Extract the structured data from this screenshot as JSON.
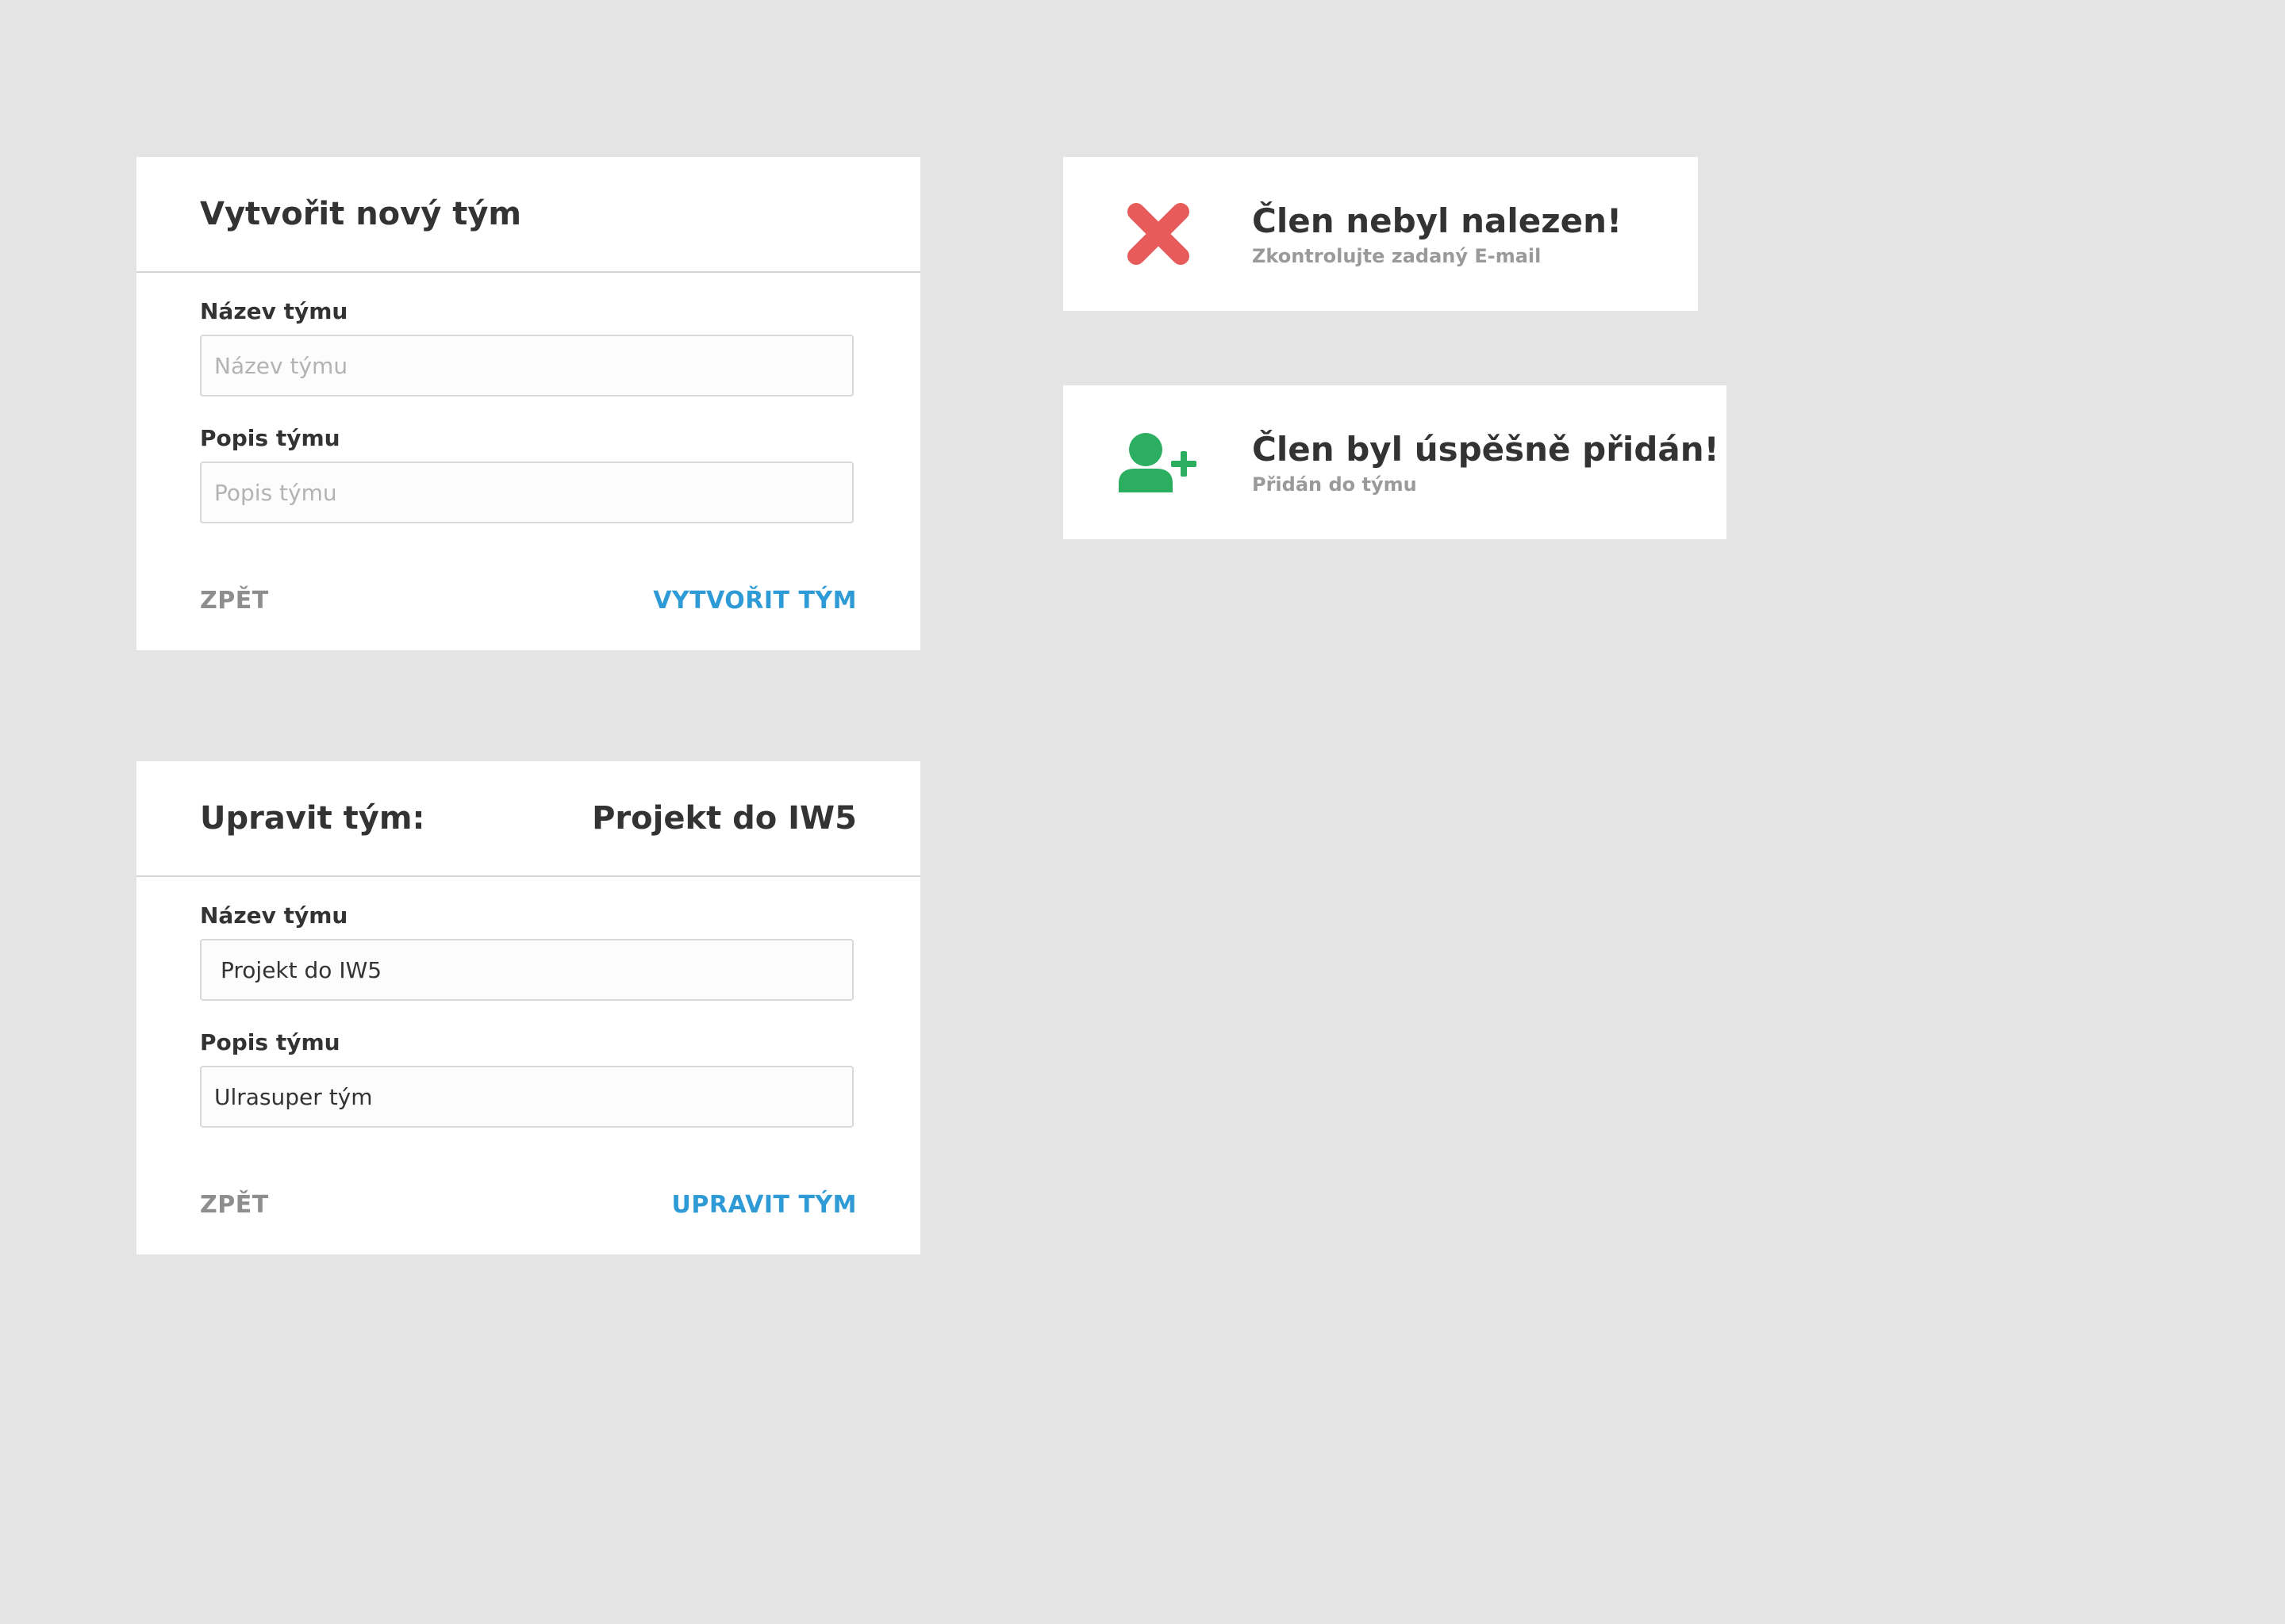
{
  "create_team": {
    "title": "Vytvořit nový tým",
    "name_label": "Název týmu",
    "name_placeholder": "Název týmu",
    "name_value": "",
    "desc_label": "Popis týmu",
    "desc_placeholder": "Popis týmu",
    "desc_value": "",
    "back_label": "ZPĚT",
    "submit_label": "VYTVOŘIT TÝM"
  },
  "edit_team": {
    "title": "Upravit tým:",
    "team_name": "Projekt do IW5",
    "name_label": "Název týmu",
    "name_value": "Projekt do IW5",
    "desc_label": "Popis týmu",
    "desc_value": "Ulrasuper tým",
    "back_label": "ZPĚT",
    "submit_label": "UPRAVIT TÝM"
  },
  "notifications": {
    "error": {
      "icon": "close-icon",
      "color": "#e85b5b",
      "title": "Člen nebyl nalezen!",
      "subtitle": "Zkontrolujte zadaný E-mail"
    },
    "success": {
      "icon": "add-user-icon",
      "color": "#2bae5f",
      "title": "Člen byl úspěšně přidán!",
      "subtitle": "Přidán do týmu"
    }
  },
  "colors": {
    "background": "#e4e4e4",
    "card": "#ffffff",
    "accent": "#2e9bd6",
    "muted": "#8e8e8e"
  }
}
